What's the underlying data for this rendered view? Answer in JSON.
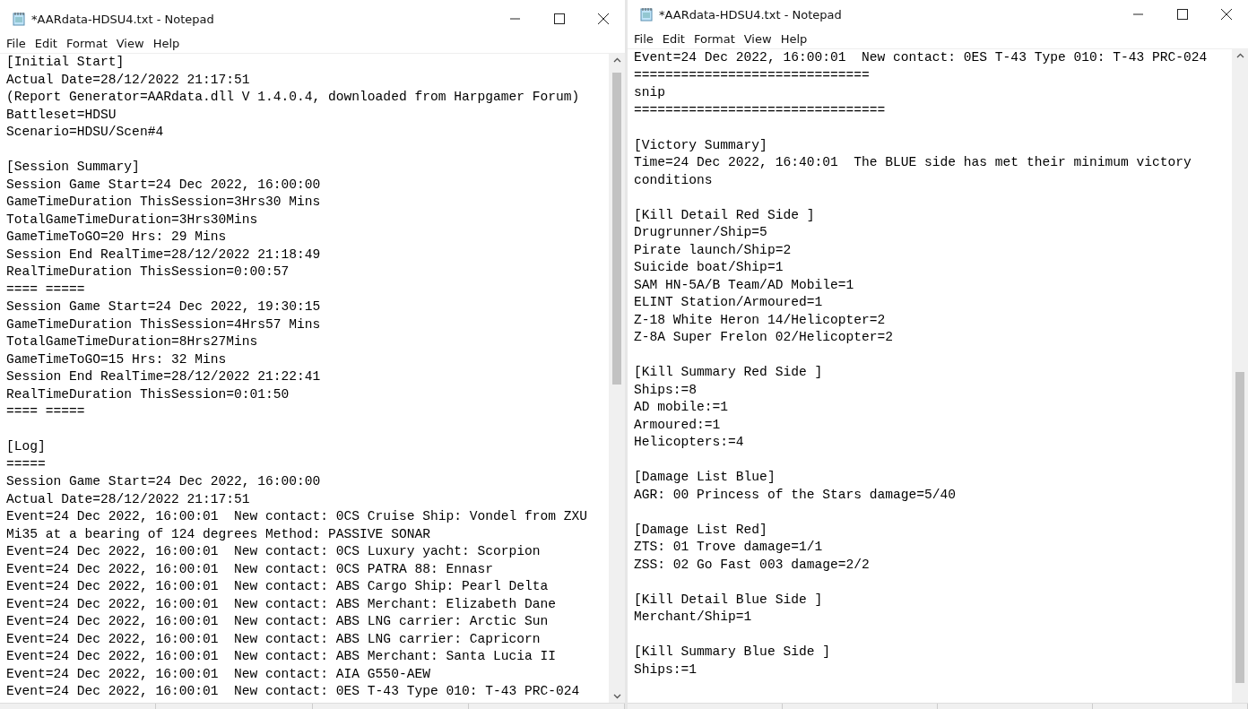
{
  "windows": [
    {
      "title": "*AARdata-HDSU4.txt - Notepad",
      "menu": [
        "File",
        "Edit",
        "Format",
        "View",
        "Help"
      ],
      "blocks": [
        [
          "[Initial Start]",
          "Actual Date=28/12/2022 21:17:51",
          "(Report Generator=AARdata.dll V 1.4.0.4, downloaded from Harpgamer Forum)",
          "Battleset=HDSU",
          "Scenario=HDSU/Scen#4"
        ],
        [
          "[Session Summary]",
          "Session Game Start=24 Dec 2022, 16:00:00",
          "GameTimeDuration ThisSession=3Hrs30 Mins",
          "TotalGameTimeDuration=3Hrs30Mins",
          "GameTimeToGO=20 Hrs: 29 Mins",
          "Session End RealTime=28/12/2022 21:18:49",
          "RealTimeDuration ThisSession=0:00:57",
          "==== =====",
          "Session Game Start=24 Dec 2022, 19:30:15",
          "GameTimeDuration ThisSession=4Hrs57 Mins",
          "TotalGameTimeDuration=8Hrs27Mins",
          "GameTimeToGO=15 Hrs: 32 Mins",
          "Session End RealTime=28/12/2022 21:22:41",
          "RealTimeDuration ThisSession=0:01:50",
          "==== ====="
        ],
        [
          "[Log]",
          "=====",
          "Session Game Start=24 Dec 2022, 16:00:00",
          "Actual Date=28/12/2022 21:17:51",
          "Event=24 Dec 2022, 16:00:01  New contact: 0CS Cruise Ship: Vondel from ZXU",
          "Mi35 at a bearing of 124 degrees Method: PASSIVE SONAR",
          "Event=24 Dec 2022, 16:00:01  New contact: 0CS Luxury yacht: Scorpion",
          "Event=24 Dec 2022, 16:00:01  New contact: 0CS PATRA 88: Ennasr",
          "Event=24 Dec 2022, 16:00:01  New contact: ABS Cargo Ship: Pearl Delta",
          "Event=24 Dec 2022, 16:00:01  New contact: ABS Merchant: Elizabeth Dane",
          "Event=24 Dec 2022, 16:00:01  New contact: ABS LNG carrier: Arctic Sun",
          "Event=24 Dec 2022, 16:00:01  New contact: ABS LNG carrier: Capricorn",
          "Event=24 Dec 2022, 16:00:01  New contact: ABS Merchant: Santa Lucia II",
          "Event=24 Dec 2022, 16:00:01  New contact: AIA G550-AEW",
          "Event=24 Dec 2022, 16:00:01  New contact: 0ES T-43 Type 010: T-43 PRC-024"
        ]
      ]
    },
    {
      "title": "*AARdata-HDSU4.txt - Notepad",
      "menu": [
        "File",
        "Edit",
        "Format",
        "View",
        "Help"
      ],
      "blocks": [
        [
          "Event=24 Dec 2022, 16:00:01  New contact: 0ES T-43 Type 010: T-43 PRC-024",
          "==============================",
          "snip",
          "================================"
        ],
        [
          "[Victory Summary]",
          "Time=24 Dec 2022, 16:40:01  The BLUE side has met their minimum victory",
          "conditions"
        ],
        [
          "[Kill Detail Red Side ]",
          "Drugrunner/Ship=5",
          "Pirate launch/Ship=2",
          "Suicide boat/Ship=1",
          "SAM HN-5A/B Team/AD Mobile=1",
          "ELINT Station/Armoured=1",
          "Z-18 White Heron 14/Helicopter=2",
          "Z-8A Super Frelon 02/Helicopter=2"
        ],
        [
          "[Kill Summary Red Side ]",
          "Ships:=8",
          "AD mobile:=1",
          "Armoured:=1",
          "Helicopters:=4"
        ],
        [
          "[Damage List Blue]",
          "AGR: 00 Princess of the Stars damage=5/40"
        ],
        [
          "[Damage List Red]",
          "ZTS: 01 Trove damage=1/1",
          "ZSS: 02 Go Fast 003 damage=2/2"
        ],
        [
          "[Kill Detail Blue Side ]",
          "Merchant/Ship=1"
        ],
        [
          "[Kill Summary Blue Side ]",
          "Ships:=1"
        ]
      ]
    }
  ]
}
